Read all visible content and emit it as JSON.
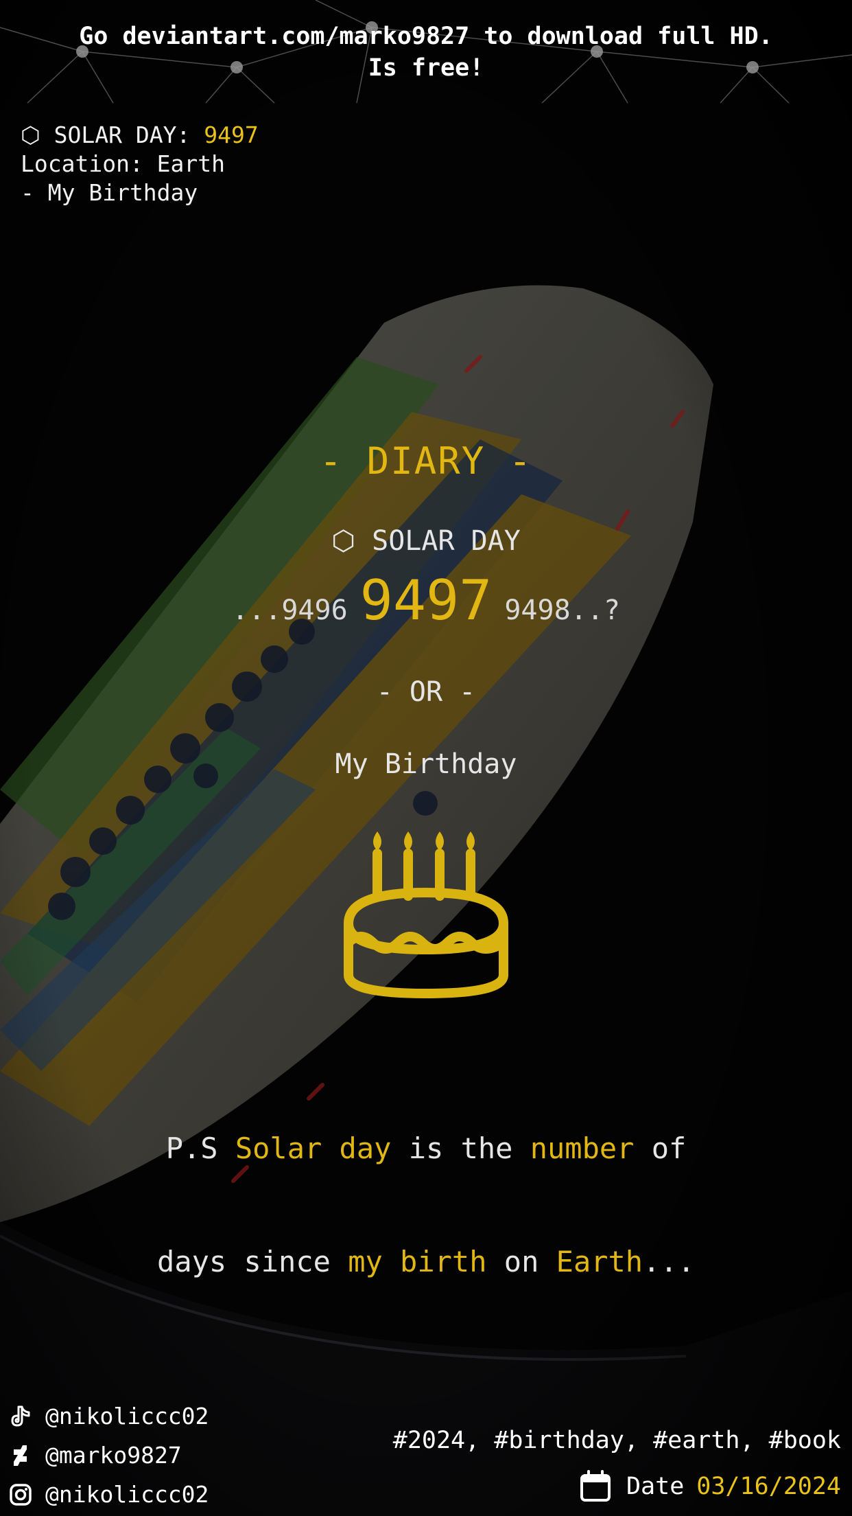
{
  "notice": {
    "line1": "Go deviantart.com/marko9827 to download full HD.",
    "line2": "Is free!"
  },
  "header": {
    "solar_label": "⬡ SOLAR DAY: ",
    "solar_value": "9497",
    "location": "Location: Earth",
    "event": "- My Birthday"
  },
  "main": {
    "title": "- DIARY -",
    "solar_day_label": "⬡ SOLAR DAY",
    "prev_day": "...9496",
    "current_day": "9497",
    "next_day": "9498..?",
    "or_label": "- OR -",
    "event_label": "My Birthday",
    "icon": "birthday-cake-icon"
  },
  "note": {
    "p1": "P.S ",
    "p2": "Solar day",
    "p3": " is the ",
    "p4": "number",
    "p5": " of",
    "p6": "days since ",
    "p7": "my birth",
    "p8": " on ",
    "p9": "Earth",
    "p10": "..."
  },
  "social": [
    {
      "icon": "tiktok-icon",
      "handle": "@nikoliccc02"
    },
    {
      "icon": "deviantart-icon",
      "handle": "@marko9827"
    },
    {
      "icon": "instagram-icon",
      "handle": "@nikoliccc02"
    }
  ],
  "footer": {
    "tags": "#2024, #birthday, #earth, #book",
    "date_label": "Date",
    "date_value": "03/16/2024"
  },
  "colors": {
    "accent": "#e2b713",
    "background": "#050505",
    "text": "#ffffff"
  }
}
